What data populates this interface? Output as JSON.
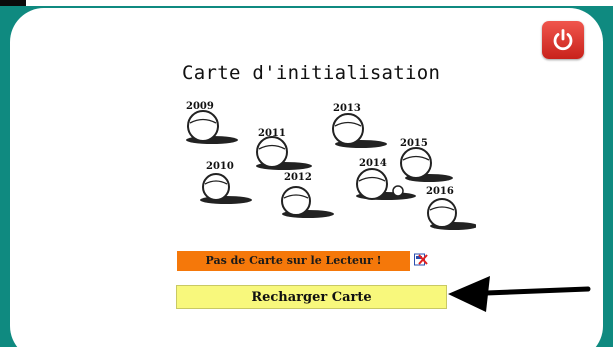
{
  "window": {
    "accent_color": "#0f8a80"
  },
  "power_button": {
    "icon": "power-icon",
    "color": "#d9322a"
  },
  "card": {
    "title": "Carte d'initialisation",
    "balls": [
      {
        "year": "2009"
      },
      {
        "year": "2011"
      },
      {
        "year": "2013"
      },
      {
        "year": "2015"
      },
      {
        "year": "2010"
      },
      {
        "year": "2012"
      },
      {
        "year": "2014"
      },
      {
        "year": "2016"
      }
    ]
  },
  "status": {
    "message": "Pas de Carte sur le Lecteur !",
    "color": "#f5780a",
    "icon": "card-error-icon"
  },
  "reload_button": {
    "label": "Recharger Carte",
    "color": "#f8f87c"
  },
  "annotation": {
    "icon": "arrow-left-icon"
  }
}
